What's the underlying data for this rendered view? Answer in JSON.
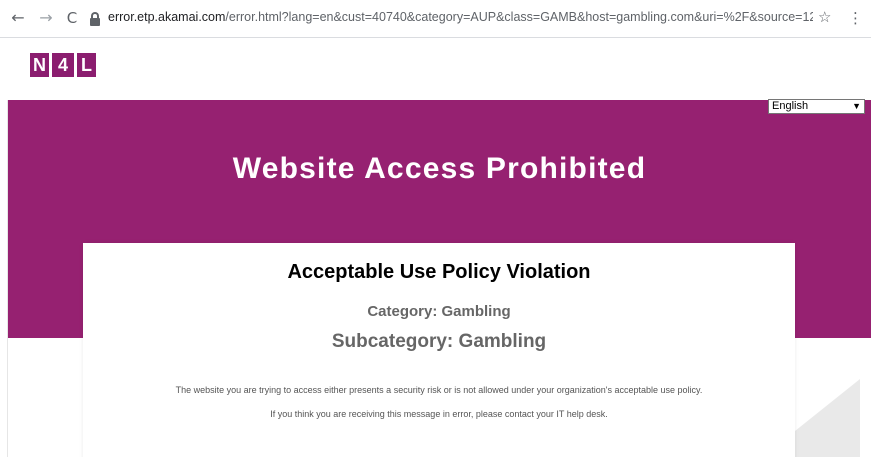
{
  "browser": {
    "back_glyph": "←",
    "forward_glyph": "→",
    "reload_glyph": "C",
    "url_host": "error.etp.akamai.com",
    "url_path": "/error.html?lang=en&cust=40740&category=AUP&class=GAMB&host=gambling.com&uri=%2F&source=125.238.196...",
    "star_glyph": "☆",
    "menu_glyph": "⋮",
    "icons": [
      "back-arrow-icon",
      "forward-arrow-icon",
      "reload-icon",
      "lock-icon",
      "bookmark-star-icon",
      "kebab-menu-icon"
    ]
  },
  "logo": {
    "letters": [
      "N",
      "4",
      "L"
    ],
    "color": "#8b1d6f"
  },
  "language": {
    "selected": "English"
  },
  "banner": {
    "title": "Website Access Prohibited",
    "color": "#962171"
  },
  "card": {
    "title": "Acceptable Use Policy Violation",
    "category": "Category: Gambling",
    "subcategory": "Subcategory: Gambling",
    "message1": "The website you are trying to access either presents a security risk or is not allowed under your organization's acceptable use policy.",
    "message2": "If you think you are receiving this message in error, please contact your IT help desk."
  }
}
